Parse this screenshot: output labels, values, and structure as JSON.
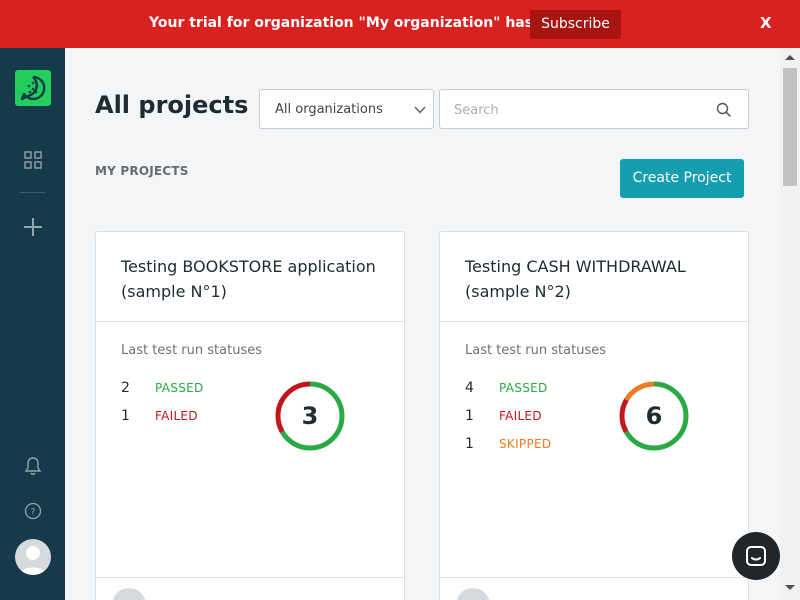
{
  "banner": {
    "message": "Your trial for organization \"My organization\" has expired.",
    "subscribe_label": "Subscribe",
    "close_label": "X"
  },
  "sidebar": {
    "items": [
      {
        "name": "projects",
        "icon": "grid-icon"
      },
      {
        "name": "new",
        "icon": "plus-icon"
      },
      {
        "name": "notifications",
        "icon": "bell-icon"
      },
      {
        "name": "help",
        "icon": "help-icon"
      },
      {
        "name": "profile",
        "icon": "user-avatar-icon"
      }
    ]
  },
  "header": {
    "title": "All projects",
    "org_filter": {
      "selected": "All organizations"
    },
    "search": {
      "placeholder": "Search",
      "value": ""
    }
  },
  "section": {
    "title": "MY PROJECTS",
    "create_label": "Create Project"
  },
  "projects": [
    {
      "title": "Testing BOOKSTORE application (sample N°1)",
      "statuses_label": "Last test run statuses",
      "total": "3",
      "stats": [
        {
          "count": "2",
          "label": "PASSED",
          "color": "#2aa944"
        },
        {
          "count": "1",
          "label": "FAILED",
          "color": "#c0171e"
        }
      ]
    },
    {
      "title": "Testing CASH WITHDRAWAL (sample N°2)",
      "statuses_label": "Last test run statuses",
      "total": "6",
      "stats": [
        {
          "count": "4",
          "label": "PASSED",
          "color": "#2aa944"
        },
        {
          "count": "1",
          "label": "FAILED",
          "color": "#c0171e"
        },
        {
          "count": "1",
          "label": "SKIPPED",
          "color": "#f07a23"
        }
      ]
    }
  ],
  "colors": {
    "banner": "#d9211f",
    "sidebar": "#173a4a",
    "brand": "#21cd5c",
    "primary_button": "#159db0",
    "passed": "#2aa944",
    "failed": "#c0171e",
    "skipped": "#f07a23"
  }
}
